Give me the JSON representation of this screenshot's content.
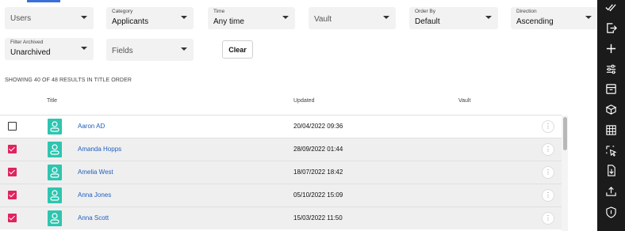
{
  "filters": {
    "users": {
      "label": "",
      "value": "Users"
    },
    "category": {
      "label": "Category",
      "value": "Applicants"
    },
    "time": {
      "label": "Time",
      "value": "Any time"
    },
    "vault": {
      "label": "",
      "value": "Vault"
    },
    "order_by": {
      "label": "Order By",
      "value": "Default"
    },
    "direction": {
      "label": "Direction",
      "value": "Ascending"
    },
    "filter_archived": {
      "label": "Filter Archived",
      "value": "Unarchived"
    },
    "fields": {
      "label": "",
      "value": "Fields"
    }
  },
  "clear_label": "Clear",
  "results_summary": "SHOWING 40 OF 48 RESULTS IN TITLE ORDER",
  "table": {
    "headers": {
      "title": "Title",
      "updated": "Updated",
      "vault": "Vault"
    },
    "rows": [
      {
        "name": "Aaron AD",
        "updated": "20/04/2022 09:36",
        "checked": false
      },
      {
        "name": "Amanda Hopps",
        "updated": "28/09/2022 01:44",
        "checked": true
      },
      {
        "name": "Amelia West",
        "updated": "18/07/2022 18:42",
        "checked": true
      },
      {
        "name": "Anna Jones",
        "updated": "05/10/2022 15:09",
        "checked": true
      },
      {
        "name": "Anna Scott",
        "updated": "15/03/2022 11:50",
        "checked": true
      }
    ],
    "row_menu_glyph": "⋮"
  },
  "colors": {
    "accent_blue": "#3a6fd8",
    "checkbox_pink": "#e0245e",
    "avatar_teal": "#2ec5b0",
    "sidebar_dark": "#1b1b1b",
    "link_blue": "#1f5fbf"
  },
  "sidebar_icons": [
    "double-check-icon",
    "export-icon",
    "plus-icon",
    "sliders-icon",
    "archive-box-icon",
    "cubes-icon",
    "table-grid-icon",
    "select-pointer-icon",
    "download-file-icon",
    "upload-tray-icon",
    "shield-icon"
  ]
}
